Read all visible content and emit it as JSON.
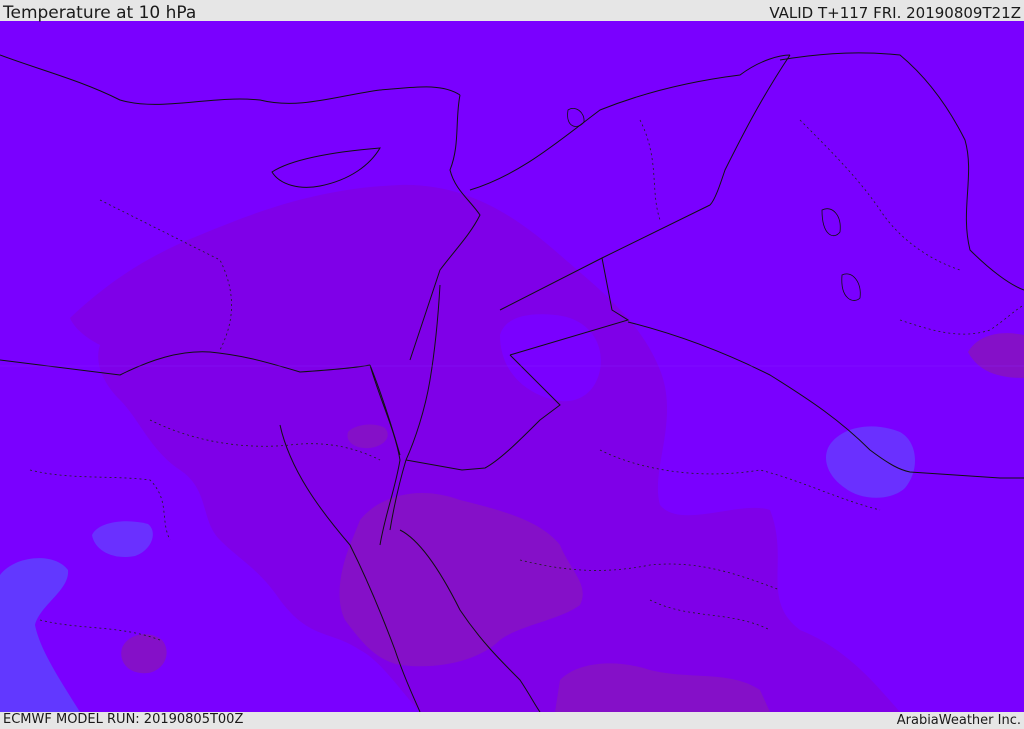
{
  "header": {
    "title": "Temperature at 10 hPa",
    "valid": "VALID T+117 FRI. 20190809T21Z"
  },
  "footer": {
    "model_run": "ECMWF MODEL RUN: 20190805T00Z",
    "credit": "ArabiaWeather Inc."
  },
  "map": {
    "field": "temperature",
    "level": "10 hPa",
    "background_color": "#7a00ff",
    "contour_colors": {
      "warm_band": "#7f00e8",
      "warmest": "#8510c8",
      "cool_patch": "#6a30ff",
      "cold_patch": "#6238ff"
    },
    "border_color": "#111111",
    "coastline_color": "#111111"
  }
}
